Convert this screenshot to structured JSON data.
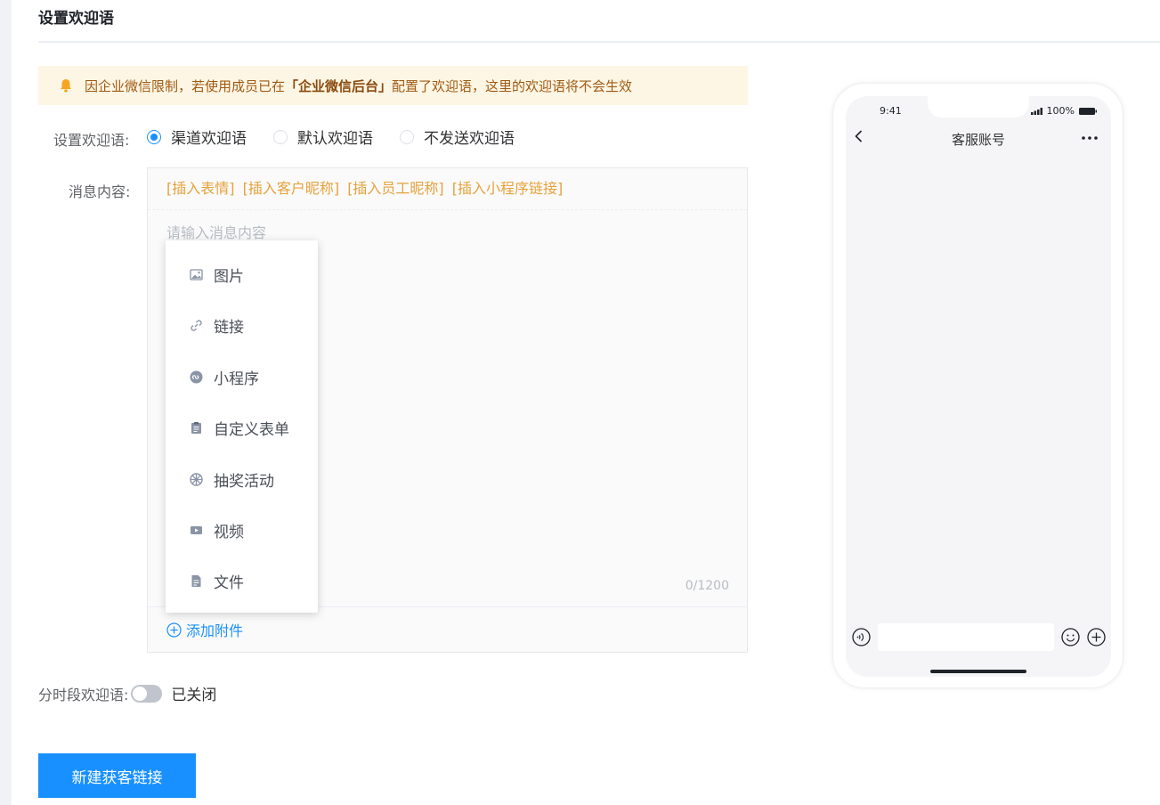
{
  "section": {
    "title": "设置欢迎语"
  },
  "notice": {
    "pre": "因企业微信限制，若使用成员已在",
    "bold": "「企业微信后台」",
    "post": "配置了欢迎语，这里的欢迎语将不会生效"
  },
  "welcome": {
    "label": "设置欢迎语:",
    "options": [
      "渠道欢迎语",
      "默认欢迎语",
      "不发送欢迎语"
    ],
    "selected": "渠道欢迎语"
  },
  "message": {
    "label": "消息内容:",
    "inserts": [
      "[插入表情]",
      "[插入客户昵称]",
      "[插入员工昵称]",
      "[插入小程序链接]"
    ],
    "placeholder": "请输入消息内容",
    "counter": "0/1200",
    "add_attachment": "添加附件"
  },
  "attachment_menu": {
    "items": [
      {
        "label": "图片",
        "icon": "image-icon"
      },
      {
        "label": "链接",
        "icon": "link-icon"
      },
      {
        "label": "小程序",
        "icon": "miniprogram-icon"
      },
      {
        "label": "自定义表单",
        "icon": "form-icon"
      },
      {
        "label": "抽奖活动",
        "icon": "lottery-icon"
      },
      {
        "label": "视频",
        "icon": "video-icon"
      },
      {
        "label": "文件",
        "icon": "file-icon"
      }
    ]
  },
  "timed": {
    "label": "分时段欢迎语:",
    "state": "已关闭",
    "enabled": false
  },
  "primary_button": "新建获客链接",
  "phone": {
    "time": "9:41",
    "battery": "100%",
    "title": "客服账号"
  },
  "colors": {
    "accent": "#1890ff",
    "insert_link": "#e6a23c",
    "notice_bg": "#fdf6e4",
    "notice_text": "#a05a14"
  }
}
